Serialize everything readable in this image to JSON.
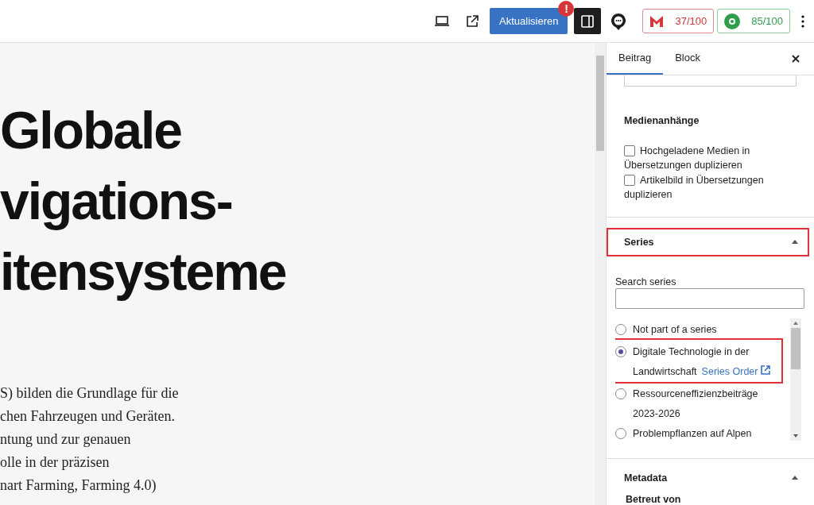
{
  "toolbar": {
    "update_button": "Aktualisieren",
    "notice_badge": "!",
    "seo_score": "37/100",
    "readability_score": "85/100"
  },
  "post": {
    "title_lines": [
      "Globale",
      "vigations-",
      "itensysteme"
    ],
    "body_lines": [
      "S) bilden die Grundlage für die",
      "chen Fahrzeugen und Geräten.",
      "ntung und zur genauen",
      "olle in der präzisen",
      "nart Farming, Farming 4.0)"
    ]
  },
  "sidebar": {
    "tabs": [
      {
        "label": "Beitrag",
        "selected": true
      },
      {
        "label": "Block",
        "selected": false
      }
    ],
    "media": {
      "title": "Medienanhänge",
      "options": [
        {
          "label": "Hochgeladene Medien in Übersetzungen duplizieren",
          "checked": false
        },
        {
          "label": "Artikelbild in Übersetzungen duplizieren",
          "checked": false
        }
      ]
    },
    "series": {
      "title": "Series",
      "expanded": true,
      "highlighted": true,
      "search_label": "Search series",
      "options": [
        {
          "label": "Not part of a series",
          "selected": false,
          "highlighted": false
        },
        {
          "label": "Digitale Technologie in der Landwirtschaft",
          "selected": true,
          "highlighted": true,
          "link": "Series Order"
        },
        {
          "label": "Ressourceneffizienzbeiträge 2023-2026",
          "selected": false,
          "highlighted": false
        },
        {
          "label": "Problempflanzen auf Alpen",
          "selected": false,
          "highlighted": false
        }
      ]
    },
    "metadata": {
      "title": "Metadata",
      "expanded": true,
      "field_label": "Betreut von"
    }
  }
}
